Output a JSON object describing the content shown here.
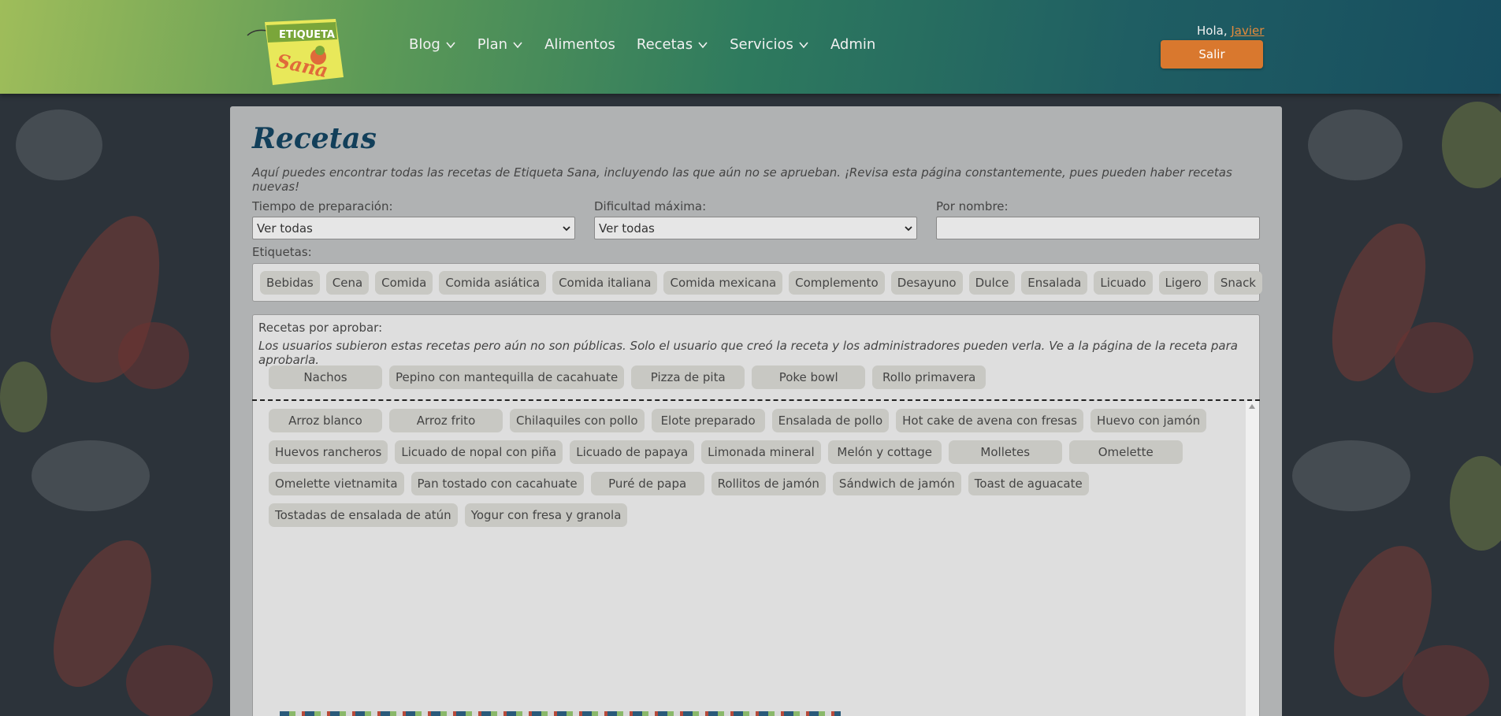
{
  "header": {
    "logo_line1": "ETIQUETA",
    "logo_line2": "Sana",
    "nav": [
      {
        "label": "Blog",
        "has_dropdown": true
      },
      {
        "label": "Plan",
        "has_dropdown": true
      },
      {
        "label": "Alimentos",
        "has_dropdown": false
      },
      {
        "label": "Recetas",
        "has_dropdown": true
      },
      {
        "label": "Servicios",
        "has_dropdown": true
      },
      {
        "label": "Admin",
        "has_dropdown": false
      }
    ],
    "greeting": "Hola,",
    "username": "Javier",
    "logout_label": "Salir"
  },
  "page": {
    "title": "Recetas",
    "description": "Aquí puedes encontrar todas las recetas de Etiqueta Sana, incluyendo las que aún no se aprueban. ¡Revisa esta página constantemente, pues pueden haber recetas nuevas!"
  },
  "filters": {
    "prep_time_label": "Tiempo de preparación:",
    "prep_time_value": "Ver todas",
    "difficulty_label": "Dificultad máxima:",
    "difficulty_value": "Ver todas",
    "name_label": "Por nombre:",
    "name_value": "",
    "tags_label": "Etiquetas:",
    "tags": [
      "Bebidas",
      "Cena",
      "Comida",
      "Comida asiática",
      "Comida italiana",
      "Comida mexicana",
      "Complemento",
      "Desayuno",
      "Dulce",
      "Ensalada",
      "Licuado",
      "Ligero",
      "Snack"
    ]
  },
  "pending": {
    "title": "Recetas por aprobar:",
    "note": "Los usuarios subieron estas recetas pero aún no son públicas. Solo el usuario que creó la receta y los administradores pueden verla. Ve a la página de la receta para aprobarla.",
    "recipes": [
      "Nachos",
      "Pepino con mantequilla de cacahuate",
      "Pizza de pita",
      "Poke bowl",
      "Rollo primavera"
    ]
  },
  "recipes": [
    "Arroz blanco",
    "Arroz frito",
    "Chilaquiles con pollo",
    "Elote preparado",
    "Ensalada de pollo",
    "Hot cake de avena con fresas",
    "Huevo con jamón",
    "Huevos rancheros",
    "Licuado de nopal con piña",
    "Licuado de papaya",
    "Limonada mineral",
    "Melón y cottage",
    "Molletes",
    "Omelette",
    "Omelette vietnamita",
    "Pan tostado con cacahuate",
    "Puré de papa",
    "Rollitos de jamón",
    "Sándwich de jamón",
    "Toast de aguacate",
    "Tostadas de ensalada de atún",
    "Yogur con fresa y granola"
  ],
  "colors": {
    "accent": "#d9782e",
    "title": "#123f5a",
    "chip": "#c8c8c3"
  }
}
